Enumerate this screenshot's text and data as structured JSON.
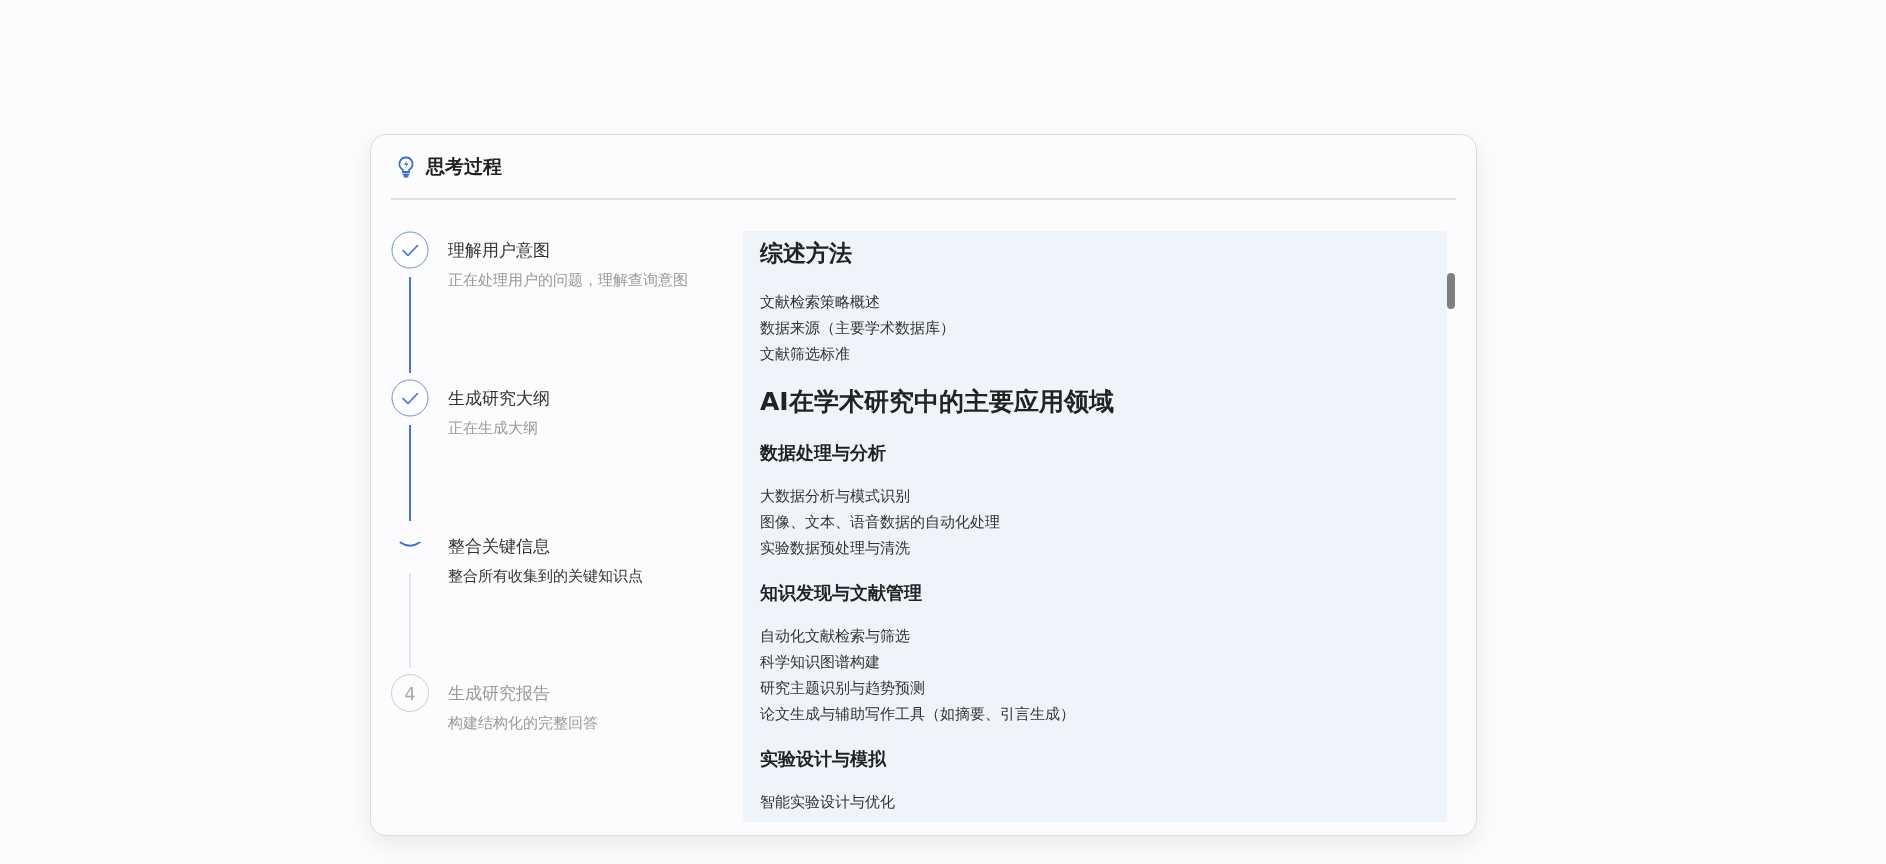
{
  "panel": {
    "title": "思考过程"
  },
  "steps": [
    {
      "title": "理解用户意图",
      "description": "正在处理用户的问题，理解查询意图",
      "done": true,
      "active": false
    },
    {
      "title": "生成研究大纲",
      "description": "正在生成大纲",
      "done": true,
      "active": false
    },
    {
      "title": "整合关键信息",
      "description": "整合所有收集到的关键知识点",
      "done": false,
      "active": true
    },
    {
      "title": "生成研究报告",
      "description": "构建结构化的完整回答",
      "done": false,
      "active": false,
      "marker": "4"
    }
  ],
  "content": [
    {
      "kind": "h2",
      "text": "综述方法"
    },
    {
      "kind": "item",
      "text": "文献检索策略概述"
    },
    {
      "kind": "item",
      "text": "数据来源（主要学术数据库）"
    },
    {
      "kind": "item",
      "text": "文献筛选标准"
    },
    {
      "kind": "h1",
      "text": "AI在学术研究中的主要应用领域"
    },
    {
      "kind": "h3",
      "text": "数据处理与分析"
    },
    {
      "kind": "item",
      "text": "大数据分析与模式识别"
    },
    {
      "kind": "item",
      "text": "图像、文本、语音数据的自动化处理"
    },
    {
      "kind": "item",
      "text": "实验数据预处理与清洗"
    },
    {
      "kind": "h3",
      "text": "知识发现与文献管理"
    },
    {
      "kind": "item",
      "text": "自动化文献检索与筛选"
    },
    {
      "kind": "item",
      "text": "科学知识图谱构建"
    },
    {
      "kind": "item",
      "text": "研究主题识别与趋势预测"
    },
    {
      "kind": "item",
      "text": "论文生成与辅助写作工具（如摘要、引言生成）"
    },
    {
      "kind": "h3",
      "text": "实验设计与模拟"
    },
    {
      "kind": "item",
      "text": "智能实验设计与优化"
    }
  ]
}
